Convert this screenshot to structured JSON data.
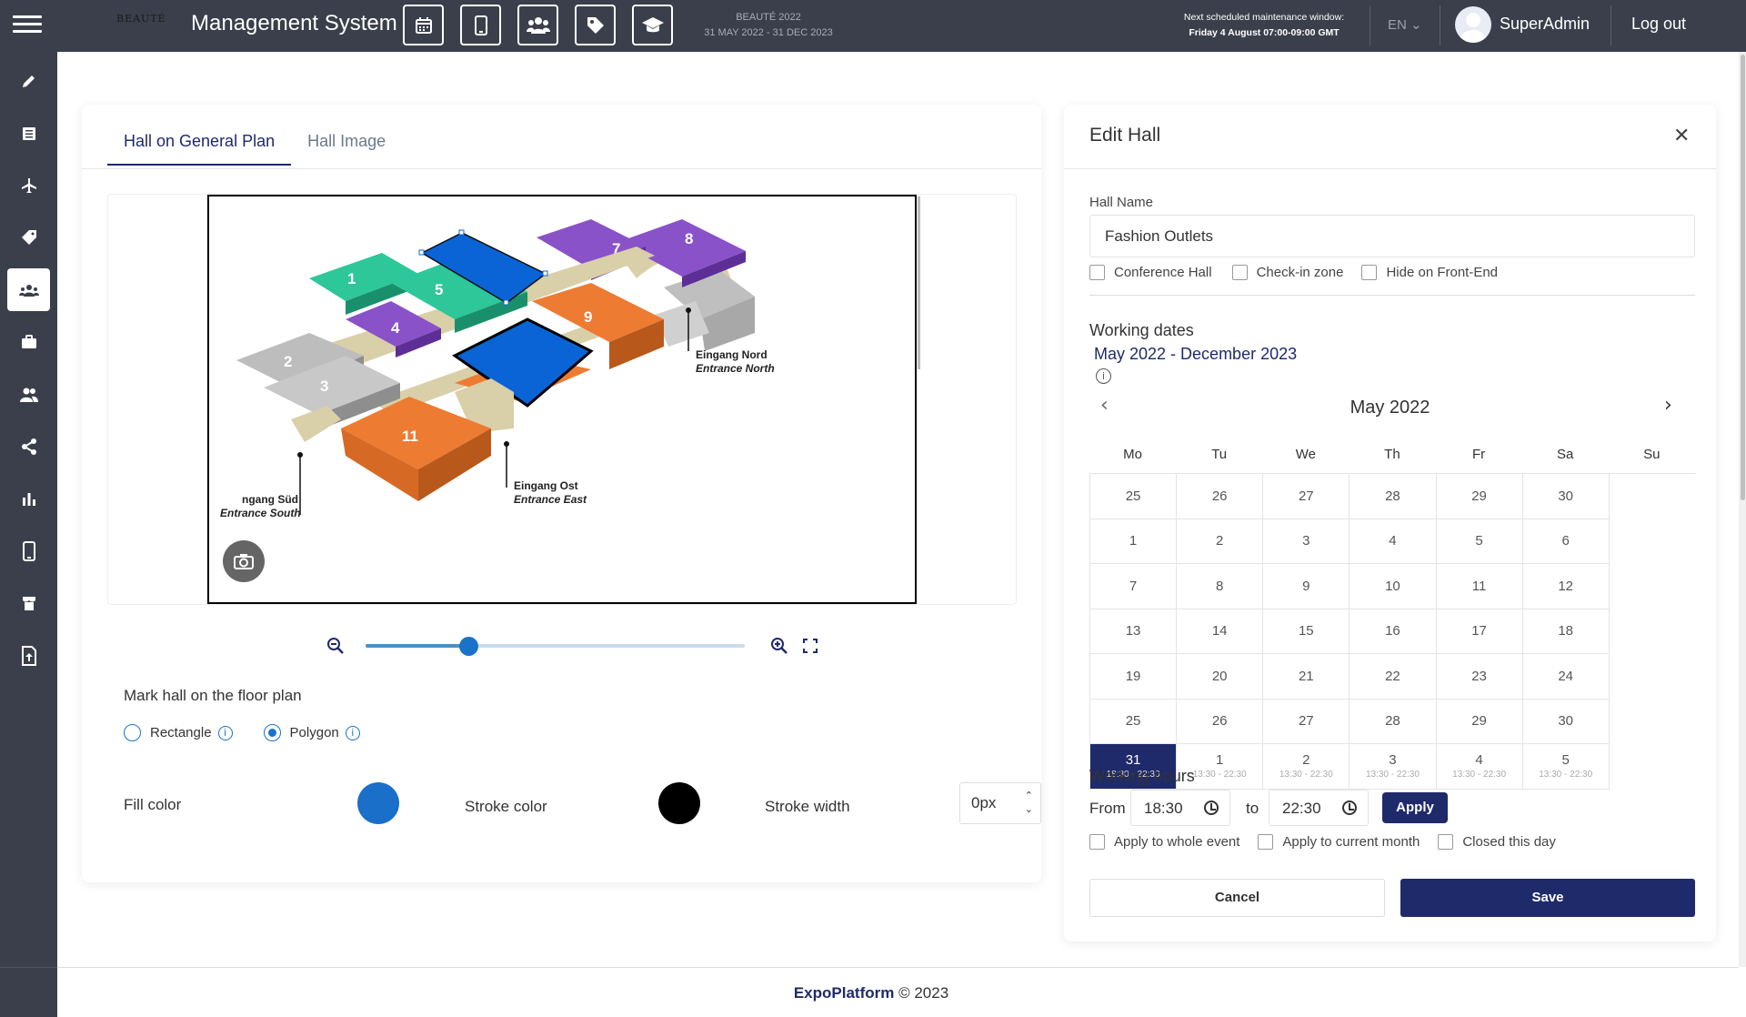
{
  "header": {
    "app_title": "Management System",
    "event_name": "BEAUTÉ 2022",
    "event_dates": "31 MAY 2022 - 31 DEC 2023",
    "maintenance_line1": "Next scheduled maintenance window:",
    "maintenance_line2": "Friday 4 August 07:00-09:00 GMT",
    "language": "EN",
    "username": "SuperAdmin",
    "logout_label": "Log out",
    "top_icons": [
      "calendar-icon",
      "tablet-icon",
      "users-icon",
      "tag-icon",
      "graduation-cap-icon"
    ]
  },
  "sidebar": {
    "items": [
      "pencil-icon",
      "list-icon",
      "plane-icon",
      "tags-icon",
      "hall-users-icon",
      "briefcase-icon",
      "people-icon",
      "share-icon",
      "bar-chart-icon",
      "mobile-icon",
      "stand-icon",
      "upload-file-icon"
    ],
    "active_index": 4
  },
  "left_panel": {
    "tabs": [
      {
        "label": "Hall on General Plan",
        "active": true
      },
      {
        "label": "Hall Image",
        "active": false
      }
    ],
    "floor_plan": {
      "hall_numbers": [
        "1",
        "2",
        "3",
        "4",
        "5",
        "7",
        "8",
        "9",
        "11"
      ],
      "labels": {
        "north_de": "Eingang Nord",
        "north_en": "Entrance North",
        "east_de": "Eingang Ost",
        "east_en": "Entrance East",
        "south_de": "ngang Süd",
        "south_en": "Entrance South"
      }
    },
    "zoom_level": 0.27,
    "mark_label": "Mark hall on the floor plan",
    "shape_options": [
      {
        "label": "Rectangle",
        "checked": false
      },
      {
        "label": "Polygon",
        "checked": true
      }
    ],
    "fill_label": "Fill color",
    "fill_color": "#1a6fc8",
    "stroke_label": "Stroke color",
    "stroke_color": "#000000",
    "stroke_width_label": "Stroke width",
    "stroke_width_value": "0px"
  },
  "edit_hall": {
    "title": "Edit Hall",
    "hall_name_label": "Hall Name",
    "hall_name_value": "Fashion Outlets",
    "checkboxes": [
      {
        "label": "Conference Hall",
        "checked": false
      },
      {
        "label": "Check-in zone",
        "checked": false
      },
      {
        "label": "Hide on Front-End",
        "checked": false
      }
    ],
    "working_dates_label": "Working dates",
    "working_dates_range": "May 2022 - December 2023",
    "calendar": {
      "month": "May 2022",
      "weekdays": [
        "Mo",
        "Tu",
        "We",
        "Th",
        "Fr",
        "Sa",
        "Su"
      ],
      "rows": [
        [
          {
            "d": "25"
          },
          {
            "d": "26"
          },
          {
            "d": "27"
          },
          {
            "d": "28"
          },
          {
            "d": "29"
          },
          {
            "d": "30"
          },
          {
            "d": "1"
          }
        ],
        [
          {
            "d": "2"
          },
          {
            "d": "3"
          },
          {
            "d": "4"
          },
          {
            "d": "5"
          },
          {
            "d": "6"
          },
          {
            "d": "7"
          },
          {
            "d": "8"
          }
        ],
        [
          {
            "d": "9"
          },
          {
            "d": "10"
          },
          {
            "d": "11"
          },
          {
            "d": "12"
          },
          {
            "d": "13"
          },
          {
            "d": "14"
          },
          {
            "d": "15"
          }
        ],
        [
          {
            "d": "16"
          },
          {
            "d": "17"
          },
          {
            "d": "18"
          },
          {
            "d": "19"
          },
          {
            "d": "20"
          },
          {
            "d": "21"
          },
          {
            "d": "22"
          }
        ],
        [
          {
            "d": "23"
          },
          {
            "d": "24"
          },
          {
            "d": "25"
          },
          {
            "d": "26"
          },
          {
            "d": "27"
          },
          {
            "d": "28"
          },
          {
            "d": "29"
          }
        ],
        [
          {
            "d": "30"
          },
          {
            "d": "31",
            "h": "18:30 - 22:30",
            "sel": true
          },
          {
            "d": "1",
            "h": "13:30 - 22:30"
          },
          {
            "d": "2",
            "h": "13:30 - 22:30"
          },
          {
            "d": "3",
            "h": "13:30 - 22:30"
          },
          {
            "d": "4",
            "h": "13:30 - 22:30"
          },
          {
            "d": "5",
            "h": "13:30 - 22:30"
          }
        ]
      ]
    },
    "working_hours_label": "Working hours",
    "from_label": "From",
    "from_value": "18:30",
    "to_label": "to",
    "to_value": "22:30",
    "apply_label": "Apply",
    "apply_options": [
      {
        "label": "Apply to whole event",
        "checked": false
      },
      {
        "label": "Apply to current month",
        "checked": false
      },
      {
        "label": "Closed this day",
        "checked": false
      }
    ],
    "cancel_label": "Cancel",
    "save_label": "Save"
  },
  "footer": {
    "brand": "ExpoPlatform",
    "copyright": "© 2023"
  }
}
